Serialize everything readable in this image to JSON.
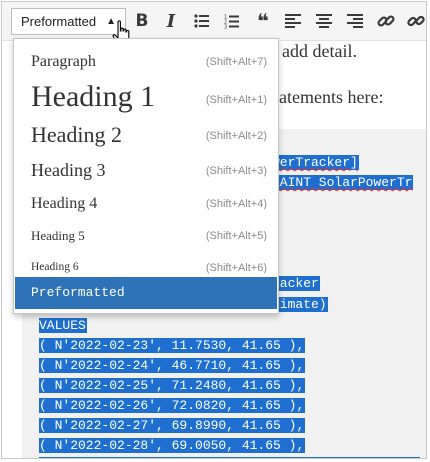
{
  "toolbar": {
    "format_value": "Preformatted",
    "buttons": [
      {
        "name": "bold-button",
        "icon": "bold-icon",
        "glyph": "B"
      },
      {
        "name": "italic-button",
        "icon": "italic-icon",
        "glyph": "I"
      },
      {
        "name": "bullet-list-button",
        "icon": "bullet-list-icon"
      },
      {
        "name": "numbered-list-button",
        "icon": "numbered-list-icon"
      },
      {
        "name": "blockquote-button",
        "icon": "quote-icon",
        "glyph": "❝"
      },
      {
        "name": "align-left-button",
        "icon": "align-left-icon"
      },
      {
        "name": "align-center-button",
        "icon": "align-center-icon"
      },
      {
        "name": "align-right-button",
        "icon": "align-right-icon"
      },
      {
        "name": "link-button",
        "icon": "link-icon"
      },
      {
        "name": "unlink-button",
        "icon": "unlink-icon"
      }
    ]
  },
  "dropdown": {
    "items": [
      {
        "label": "Paragraph",
        "shortcut": "(Shift+Alt+7)"
      },
      {
        "label": "Heading 1",
        "shortcut": "(Shift+Alt+1)"
      },
      {
        "label": "Heading 2",
        "shortcut": "(Shift+Alt+2)"
      },
      {
        "label": "Heading 3",
        "shortcut": "(Shift+Alt+3)"
      },
      {
        "label": "Heading 4",
        "shortcut": "(Shift+Alt+4)"
      },
      {
        "label": "Heading 5",
        "shortcut": "(Shift+Alt+5)"
      },
      {
        "label": "Heading 6",
        "shortcut": "(Shift+Alt+6)"
      },
      {
        "label": "Preformatted",
        "shortcut": "",
        "selected": true
      }
    ]
  },
  "editor": {
    "text_fragments": [
      "add detail.",
      "tatements here:"
    ],
    "code_fragments": [
      "werTracker]",
      "RAINT SolarPowerTr",
      "racker",
      "timate)"
    ],
    "code_lines": [
      "VALUES",
      "( N'2022-02-23', 11.7530, 41.65 ),",
      "( N'2022-02-24', 46.7710, 41.65 ),",
      "( N'2022-02-25', 71.2480, 41.65 ),",
      "( N'2022-02-26', 72.0820, 41.65 ),",
      "( N'2022-02-27', 69.8990, 41.65 ),",
      "( N'2022-02-28', 69.0050, 41.65 ),"
    ]
  },
  "colors": {
    "selection": "#1e6fcf",
    "dropdown_active": "#2e73b8"
  }
}
